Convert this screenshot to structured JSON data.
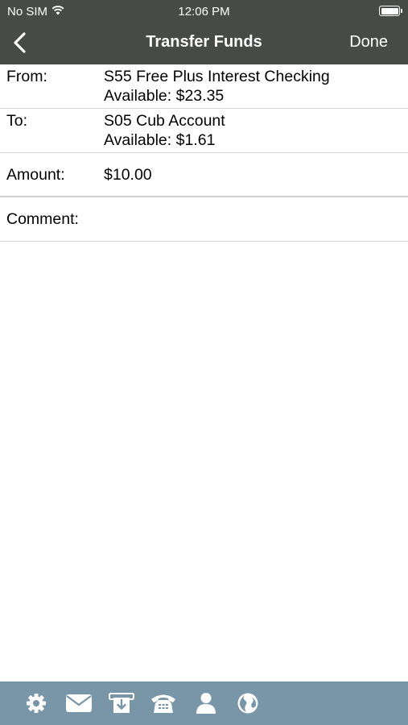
{
  "status_bar": {
    "carrier": "No SIM",
    "time": "12:06 PM"
  },
  "nav": {
    "title": "Transfer Funds",
    "done_label": "Done"
  },
  "form": {
    "from": {
      "label": "From:",
      "account": "S55 Free Plus Interest Checking",
      "available": "Available: $23.35"
    },
    "to": {
      "label": "To:",
      "account": "S05 Cub Account",
      "available": "Available: $1.61"
    },
    "amount": {
      "label": "Amount:",
      "value": "$10.00"
    },
    "comment": {
      "label": "Comment:",
      "value": ""
    }
  },
  "tabbar": {
    "icons": [
      "gear-icon",
      "mail-icon",
      "atm-deposit-icon",
      "phone-icon",
      "person-icon",
      "globe-icon"
    ],
    "background": "#7995a8"
  },
  "colors": {
    "header_bg": "#474b48",
    "tabbar_bg": "#7995a8"
  }
}
